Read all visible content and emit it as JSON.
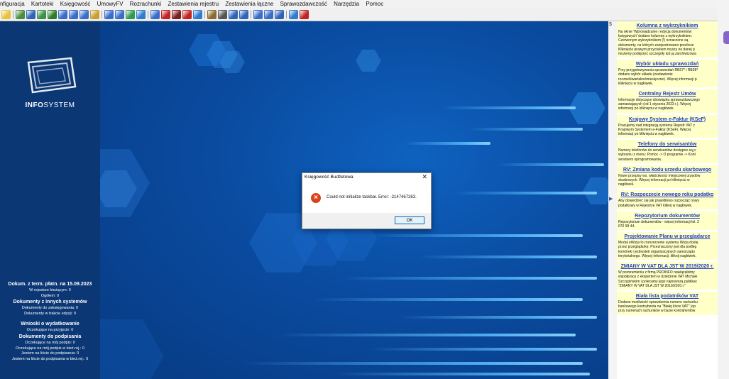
{
  "menu": [
    "nfiguracja",
    "Kartoteki",
    "Księgowość",
    "UmowyFV",
    "Rozrachunki",
    "Zestawienia rejestru",
    "Zestawienia łączne",
    "Sprawozdawczość",
    "Narzędzia",
    "Pomoc"
  ],
  "toolbar_colors": [
    "#e8c23a",
    "#4c8d3f",
    "#2f63b8",
    "#3d8f4a",
    "#2c7c2c",
    "#3a6cc9",
    "#3a6cc9",
    "#3a6cc9",
    "#c7a030",
    "#3a6cc9",
    "#3a6cc9",
    "#2f9a50",
    "#2f7bd0",
    "#3a6cc9",
    "#c02424",
    "#7a1e1e",
    "#c02424",
    "#2f7bd0",
    "#8a6a30",
    "#555555",
    "#2f63b8",
    "#2f63b8",
    "#3a6cc9",
    "#3a6cc9",
    "#2f63b8",
    "#2f7bd0",
    "#c02424"
  ],
  "logo": {
    "brand_bold": "INFO",
    "brand_rest": "SYSTEM"
  },
  "info": {
    "term_heading": "Dokum. z term. płatn. na 15.09.2023",
    "term_lines": [
      "W rejestrze bieżącym: 0",
      "Ogółem: 0"
    ],
    "other_heading": "Dokumenty z innych systemów",
    "other_lines": [
      "Dokumenty do zaksięgowania: 0",
      "Dokumenty w trakcie edycji: 0"
    ],
    "requests_heading": "Wnioski o wydatkowanie",
    "requests_lines": [
      "Oczekujące na przyjęcie: 0"
    ],
    "sign_heading": "Dokumenty do podpisania",
    "sign_lines": [
      "Oczekujące na mój podpis: 0",
      "Oczekujące na mój podpis w bież.rej.: 0",
      "Jestem na liście do podpisania: 0",
      "Jestem na liście do podpisania w bież.rej.: 0"
    ]
  },
  "dialog": {
    "title": "Księgowość Budżetowa",
    "close": "✕",
    "message": "Could not initialize taskbar. Error: -2147467263.",
    "ok_label": "OK"
  },
  "sidebar": {
    "grip_icon": "$",
    "arrow": "▶"
  },
  "news": [
    {
      "title": "Kolumna z wykrzyknikiem",
      "body": "Na oknie 'Wprowadzanie i edycja dokumentów\nksięgowych' dodano kolumnę z wykrzyknikiem.\nCzerwonym wykrzyknikiem (!) oznaczone są\ndokumenty, na których zarejestrowano przelicze\nKliknięcie prawym przyciskiem myszy na danej p\nmożemy podejrzeć szczegóły lub ją zarchiwizowa"
    },
    {
      "title": "Wybór układu sprawozdań",
      "body": "Przy przygotowywaniu sprawozdań RB27* i RB28*\ndodano wybór układu (zestawienie\nroczne/kwartalne/miesięczne). Więcej informacji p\nkliknięciu w nagłówek."
    },
    {
      "title": "Centralny Rejestr Umów",
      "body": "Informacje dotyczące obowiązku sprawozdawczego\nzamawiających (od 1 stycznia 2023 r.). Więcej\ninformacji po kliknięciu w nagłówek."
    },
    {
      "title": "Krajowy System e-Faktur (KSeF)",
      "body": "Pracujemy nad integracją systemu Rejestr VAT z\nKrajowym Systemem e-Faktur (KSeF). Więcej\ninformacji po kliknięciu w nagłówek."
    },
    {
      "title": "Telefony do serwisantów",
      "body": "Numery telefonów do serwisantów dostępne są p\nwybraniu z menu: Pomoc -> O programie -> Kont\nserwisem oprogramowania."
    },
    {
      "title": "RV: Zmiana kodu urzedu skarbowego",
      "body": "Nowe przepisy ws. właściwości miejscowej urzędów\nskarbowych. Więcej informacji po kliknięciu w\nnagłówek."
    },
    {
      "title": "RV: Rozpoczecie nowego roku podatko",
      "body": "Aby dowiedzieć się jak prawidłowo rozpocząć nowy\npodatkowy w Rejestrze VAT kliknij w nagłówek."
    },
    {
      "title": "Repozytorium dokumentów",
      "body": "Repozytorium dokumentów - więcej informacji tel. 2\n670 99 44."
    },
    {
      "title": "Projektowanie Planu w przegladarce",
      "body": "Moduł eWizja to rozszerzenie systemu Wizja dostę\nprzez przeglądarkę. Przeznaczony jest dla podleg\nkomórek i jednostek organizacyjnych samorządu\nterytorialnego. Więcej informacji, kliknij nagłówek."
    },
    {
      "title": "ZMIANY W VAT DLA JST W 2019/2020 r.",
      "body": "W porozumieniu z firmą PROINFO nawiązaliśmy\nwspółpracę z ekspertem w dziedzinie VAT Michałe\nSzczypińskim i polecamy jego najnowszą publikac\n\"ZMIANY W VAT DLA JST W 2019/2020 r.\""
    },
    {
      "title": "Biała lista podatników VAT",
      "body": "Dodano możliwość sprawdzenia numeru rachunku\nbankowego kontrahenta na \"Białej liście VAT\" (op\nprzy numerach rachunków w bazie kontrahentów"
    }
  ]
}
